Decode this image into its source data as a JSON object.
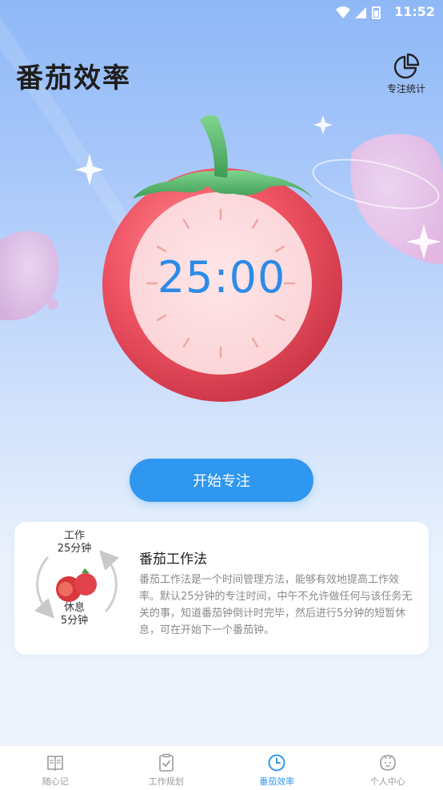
{
  "status": {
    "time": "11:52"
  },
  "header": {
    "title": "番茄效率",
    "stats_label": "专注统计"
  },
  "timer": {
    "display": "25:00"
  },
  "actions": {
    "start_label": "开始专注"
  },
  "info": {
    "cycle_work_line1": "工作",
    "cycle_work_line2": "25分钟",
    "cycle_rest_line1": "休息",
    "cycle_rest_line2": "5分钟",
    "title": "番茄工作法",
    "description": "番茄工作法是一个时间管理方法，能够有效地提高工作效率。默认25分钟的专注时间，中午不允许做任何与该任务无关的事，知道番茄钟倒计时完毕，然后进行5分钟的短暂休息，可在开始下一个番茄钟。"
  },
  "nav": {
    "items": [
      {
        "label": "随心记",
        "icon": "book-icon"
      },
      {
        "label": "工作规划",
        "icon": "checklist-icon"
      },
      {
        "label": "番茄效率",
        "icon": "clock-icon"
      },
      {
        "label": "个人中心",
        "icon": "face-icon"
      }
    ],
    "active_index": 2
  },
  "colors": {
    "accent": "#2f97ef",
    "tomato": "#e64a5a",
    "leaf": "#57b86a"
  }
}
